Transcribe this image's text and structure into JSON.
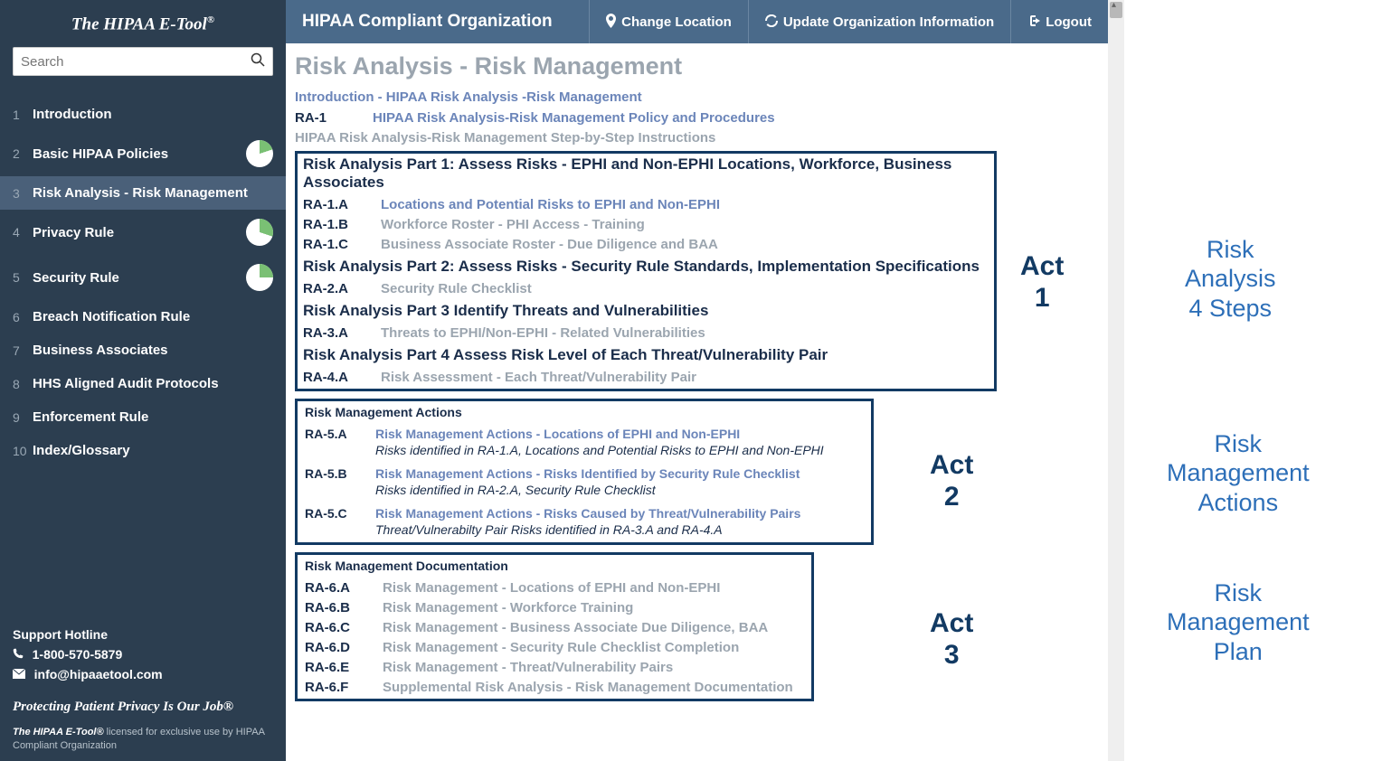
{
  "brand": "The HIPAA E-Tool",
  "brand_reg": "®",
  "search_placeholder": "Search",
  "nav": [
    {
      "num": "1",
      "label": "Introduction",
      "pie": null
    },
    {
      "num": "2",
      "label": "Basic HIPAA Policies",
      "pie": 20
    },
    {
      "num": "3",
      "label": "Risk Analysis - Risk Management",
      "pie": null,
      "selected": true
    },
    {
      "num": "4",
      "label": "Privacy Rule",
      "pie": 30
    },
    {
      "num": "5",
      "label": "Security Rule",
      "pie": 25
    },
    {
      "num": "6",
      "label": "Breach Notification Rule",
      "pie": null
    },
    {
      "num": "7",
      "label": "Business Associates",
      "pie": null
    },
    {
      "num": "8",
      "label": "HHS Aligned Audit Protocols",
      "pie": null
    },
    {
      "num": "9",
      "label": "Enforcement Rule",
      "pie": null
    },
    {
      "num": "10",
      "label": "Index/Glossary",
      "pie": null
    }
  ],
  "support_title": "Support Hotline",
  "support_phone": "1-800-570-5879",
  "support_email": "info@hipaaetool.com",
  "motto": "Protecting Patient Privacy Is Our Job®",
  "license_bold": "The HIPAA E-Tool®",
  "license_rest": " licensed for exclusive use by HIPAA Compliant Organization",
  "topbar": {
    "org": "HIPAA Compliant Organization",
    "change_location": "Change Location",
    "update_org": "Update Organization Information",
    "logout": "Logout"
  },
  "page_title": "Risk Analysis - Risk Management",
  "intro_link": "Introduction - HIPAA Risk Analysis -Risk Management",
  "ra1": {
    "code": "RA-1",
    "label": "HIPAA Risk Analysis-Risk Management Policy and Procedures"
  },
  "step_link": "HIPAA Risk Analysis-Risk Management Step-by-Step Instructions",
  "part1_title": "Risk Analysis Part 1: Assess Risks - EPHI and Non-EPHI Locations, Workforce, Business Associates",
  "ra1a": {
    "code": "RA-1.A",
    "label": "Locations and Potential Risks to EPHI and Non-EPHI"
  },
  "ra1b": {
    "code": "RA-1.B",
    "label": "Workforce Roster - PHI Access - Training"
  },
  "ra1c": {
    "code": "RA-1.C",
    "label": "Business Associate Roster - Due Diligence and BAA"
  },
  "part2_title": "Risk Analysis Part 2: Assess Risks - Security Rule Standards, Implementation Specifications",
  "ra2a": {
    "code": "RA-2.A",
    "label": "Security Rule Checklist"
  },
  "part3_title": "Risk Analysis Part 3 Identify Threats and Vulnerabilities",
  "ra3a": {
    "code": "RA-3.A",
    "label": "Threats to EPHI/Non-EPHI - Related Vulnerabilities"
  },
  "part4_title": "Risk Analysis Part 4 Assess Risk Level of Each Threat/Vulnerability Pair",
  "ra4a": {
    "code": "RA-4.A",
    "label": "Risk Assessment - Each Threat/Vulnerability Pair"
  },
  "actions_title": "Risk Management Actions",
  "ra5a": {
    "code": "RA-5.A",
    "label": "Risk Management Actions - Locations of EPHI and Non-EPHI",
    "desc": "Risks identified in RA-1.A, Locations and Potential Risks to EPHI and Non-EPHI"
  },
  "ra5b": {
    "code": "RA-5.B",
    "label": "Risk Management Actions - Risks Identified by Security Rule Checklist",
    "desc": "Risks identified in RA-2.A, Security Rule Checklist"
  },
  "ra5c": {
    "code": "RA-5.C",
    "label": "Risk Management Actions - Risks Caused by Threat/Vulnerability Pairs",
    "desc": "Threat/Vulnerabilty Pair Risks identified in RA-3.A and RA-4.A"
  },
  "doc_title": "Risk Management Documentation",
  "ra6a": {
    "code": "RA-6.A",
    "label": "Risk Management - Locations of EPHI and Non-EPHI"
  },
  "ra6b": {
    "code": "RA-6.B",
    "label": "Risk Management - Workforce Training"
  },
  "ra6c": {
    "code": "RA-6.C",
    "label": "Risk Management - Business Associate Due Diligence, BAA"
  },
  "ra6d": {
    "code": "RA-6.D",
    "label": "Risk Management - Security Rule Checklist Completion"
  },
  "ra6e": {
    "code": "RA-6.E",
    "label": "Risk Management - Threat/Vulnerability Pairs"
  },
  "ra6f": {
    "code": "RA-6.F",
    "label": "Supplemental Risk Analysis - Risk Management Documentation"
  },
  "act1": "Act\n1",
  "act2": "Act\n2",
  "act3": "Act\n3",
  "annot1": "Risk\nAnalysis\n4 Steps",
  "annot2": "Risk\nManagement\nActions",
  "annot3": "Risk\nManagement\nPlan"
}
